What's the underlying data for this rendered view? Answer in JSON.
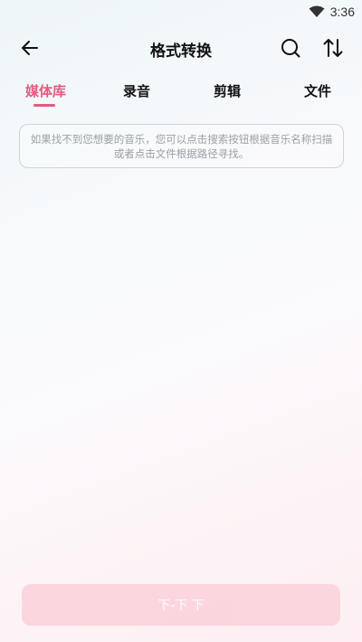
{
  "status_bar": {
    "time": "3:36",
    "wifi_icon": "wifi-icon"
  },
  "header": {
    "title": "格式转换",
    "back_icon": "arrow-left-icon",
    "search_icon": "search-icon",
    "sort_icon": "sort-icon"
  },
  "tabs": [
    {
      "label": "媒体库",
      "active": true
    },
    {
      "label": "录音",
      "active": false
    },
    {
      "label": "剪辑",
      "active": false
    },
    {
      "label": "文件",
      "active": false
    }
  ],
  "hint": {
    "text": "如果找不到您想要的音乐，您可以点击搜索按钮根据音乐名称扫描或者点击文件根据路径寻找。"
  },
  "footer": {
    "button_label": "下-下 下"
  },
  "colors": {
    "accent": "#e8587f",
    "button_bg": "#fbd3dc"
  }
}
